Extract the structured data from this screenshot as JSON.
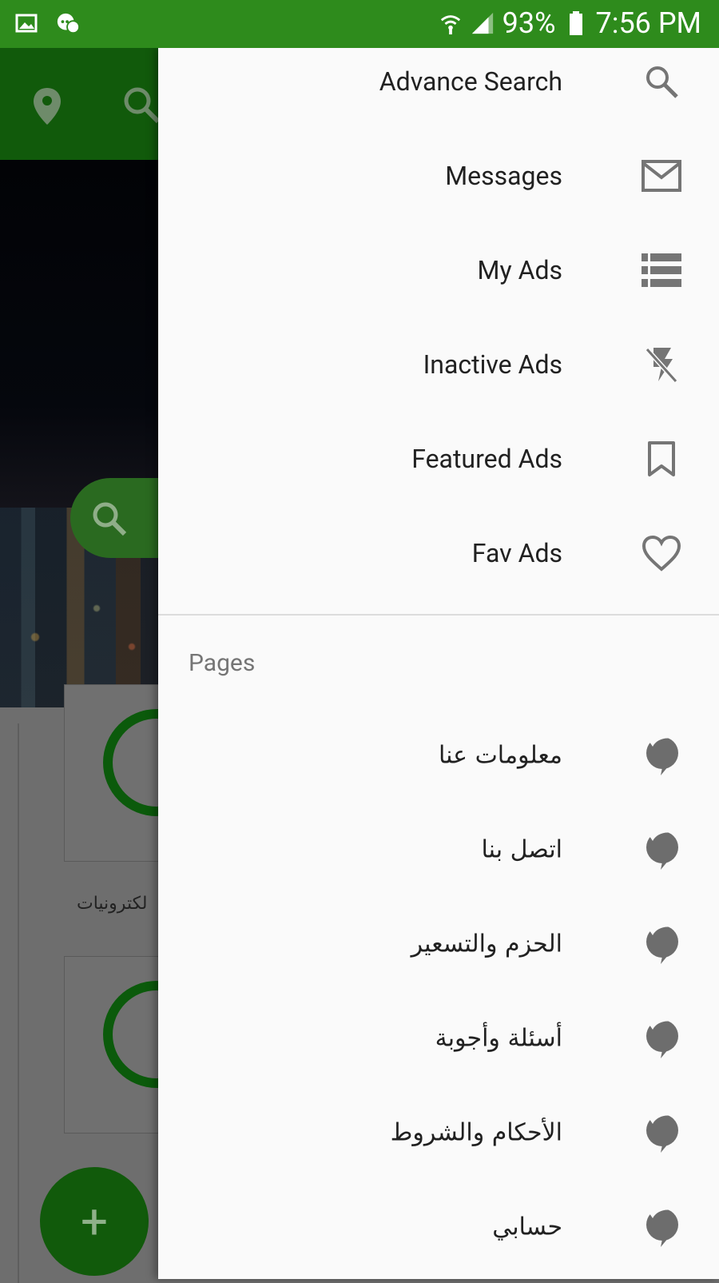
{
  "status_bar": {
    "battery": "93%",
    "time": "7:56 PM"
  },
  "background": {
    "card_label": "لكترونيات"
  },
  "fab": {
    "label": "+"
  },
  "drawer": {
    "menu_items": [
      {
        "label": "Advance Search",
        "icon": "search-icon"
      },
      {
        "label": "Messages",
        "icon": "mail-icon"
      },
      {
        "label": "My Ads",
        "icon": "list-icon"
      },
      {
        "label": "Inactive Ads",
        "icon": "flash-off-icon"
      },
      {
        "label": "Featured Ads",
        "icon": "bookmark-icon"
      },
      {
        "label": "Fav Ads",
        "icon": "heart-icon"
      }
    ],
    "pages_title": "Pages",
    "pages": [
      {
        "label": "معلومات عنا",
        "icon": "chat-bubble-icon"
      },
      {
        "label": "اتصل بنا",
        "icon": "chat-bubble-icon"
      },
      {
        "label": "الحزم والتسعير",
        "icon": "chat-bubble-icon"
      },
      {
        "label": "أسئلة وأجوبة",
        "icon": "chat-bubble-icon"
      },
      {
        "label": "الأحكام والشروط",
        "icon": "chat-bubble-icon"
      },
      {
        "label": "حسابي",
        "icon": "chat-bubble-icon"
      }
    ]
  },
  "colors": {
    "status_bar": "#2e8b1c",
    "toolbar": "#115a0b",
    "drawer_bg": "#fafafa",
    "icon_gray": "#757575"
  }
}
